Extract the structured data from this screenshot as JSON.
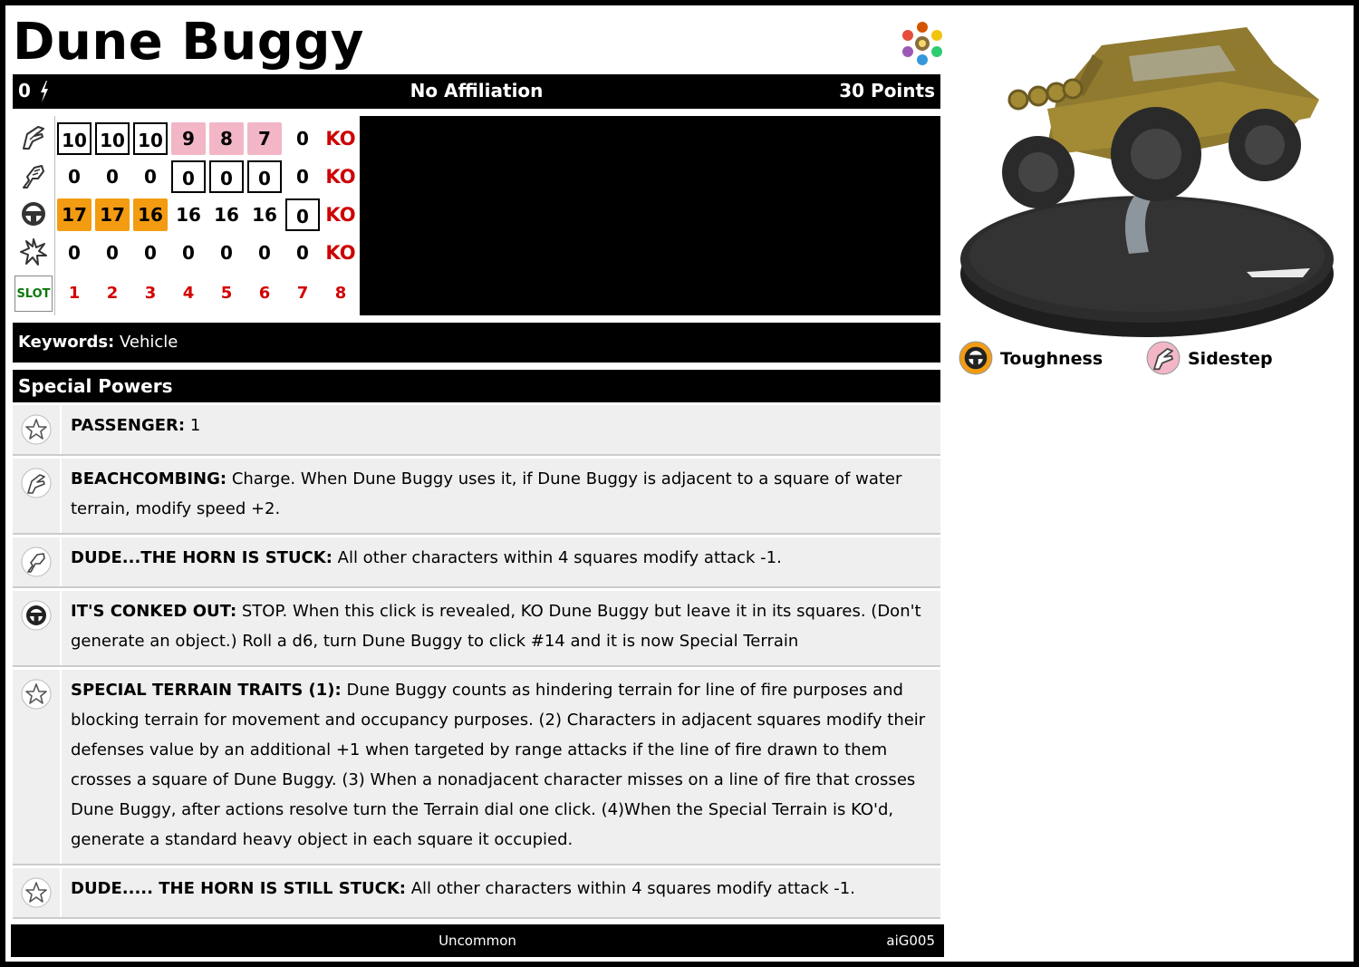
{
  "card": {
    "title": "Dune Buggy",
    "cost": "0",
    "affiliation": "No Affiliation",
    "points": "30 Points",
    "keywords_label": "Keywords:",
    "keywords_value": "Vehicle",
    "special_powers_label": "Special Powers",
    "rarity": "Uncommon",
    "set_code": "aiG005"
  },
  "dial": {
    "rows": [
      {
        "stat": "speed",
        "icon": "boot-icon",
        "cells": [
          {
            "v": "10",
            "s": "box"
          },
          {
            "v": "10",
            "s": "box"
          },
          {
            "v": "10",
            "s": "box"
          },
          {
            "v": "9",
            "s": "pink"
          },
          {
            "v": "8",
            "s": "pink"
          },
          {
            "v": "7",
            "s": "pink"
          },
          {
            "v": "0",
            "s": ""
          },
          {
            "v": "KO",
            "s": "ko"
          }
        ]
      },
      {
        "stat": "attack",
        "icon": "fist-icon",
        "cells": [
          {
            "v": "0",
            "s": ""
          },
          {
            "v": "0",
            "s": ""
          },
          {
            "v": "0",
            "s": ""
          },
          {
            "v": "0",
            "s": "box"
          },
          {
            "v": "0",
            "s": "box"
          },
          {
            "v": "0",
            "s": "box"
          },
          {
            "v": "0",
            "s": ""
          },
          {
            "v": "KO",
            "s": "ko"
          }
        ]
      },
      {
        "stat": "defense",
        "icon": "steering-wheel-icon",
        "cells": [
          {
            "v": "17",
            "s": "orange"
          },
          {
            "v": "17",
            "s": "orange"
          },
          {
            "v": "16",
            "s": "orange"
          },
          {
            "v": "16",
            "s": ""
          },
          {
            "v": "16",
            "s": ""
          },
          {
            "v": "16",
            "s": ""
          },
          {
            "v": "0",
            "s": "box"
          },
          {
            "v": "KO",
            "s": "ko"
          }
        ]
      },
      {
        "stat": "damage",
        "icon": "starburst-icon",
        "cells": [
          {
            "v": "0",
            "s": ""
          },
          {
            "v": "0",
            "s": ""
          },
          {
            "v": "0",
            "s": ""
          },
          {
            "v": "0",
            "s": ""
          },
          {
            "v": "0",
            "s": ""
          },
          {
            "v": "0",
            "s": ""
          },
          {
            "v": "0",
            "s": ""
          },
          {
            "v": "KO",
            "s": "ko"
          }
        ]
      }
    ],
    "slot_label": "SLOT",
    "slots": [
      "1",
      "2",
      "3",
      "4",
      "5",
      "6",
      "7",
      "8"
    ]
  },
  "powers": [
    {
      "icon": "star-icon",
      "name": "PASSENGER:",
      "text": " 1"
    },
    {
      "icon": "boot-icon",
      "name": "BEACHCOMBING:",
      "text": " Charge. When Dune Buggy uses it, if Dune Buggy is adjacent to a square of water terrain, modify speed +2."
    },
    {
      "icon": "fist-icon",
      "name": "DUDE...THE HORN IS STUCK:",
      "text": " All other characters within 4 squares modify attack -1."
    },
    {
      "icon": "steering-wheel-icon",
      "name": "IT'S CONKED OUT:",
      "text": " STOP. When this click is revealed, KO Dune Buggy but leave it in its squares. (Don't generate an object.) Roll a d6, turn Dune Buggy to click #14 and it is now Special Terrain"
    },
    {
      "icon": "star-icon",
      "name": "SPECIAL TERRAIN TRAITS (1):",
      "text": " Dune Buggy counts as hindering terrain for line of fire purposes and blocking terrain for movement and occupancy purposes. (2) Characters in adjacent squares modify their defenses value by an additional +1 when targeted by range attacks if the line of fire drawn to them crosses a square of Dune Buggy. (3) When a nonadjacent character misses on a line of fire that crosses Dune Buggy, after actions resolve turn the Terrain dial one click. (4)When the Special Terrain is KO'd, generate a standard heavy object in each square it occupied."
    },
    {
      "icon": "star-icon",
      "name": "DUDE..... THE HORN IS STILL STUCK:",
      "text": " All other characters within 4 squares modify attack -1."
    }
  ],
  "legend": [
    {
      "icon": "steering-wheel-icon",
      "label": "Toughness",
      "color": "#f39c12"
    },
    {
      "icon": "boot-icon",
      "label": "Sidestep",
      "color": "#f2b6c6"
    }
  ],
  "colors": {
    "pink": "#f2b6c6",
    "orange": "#f39c12",
    "ko": "#cc0000",
    "slot": "#d40000",
    "slot_label": "#0a7a0a"
  }
}
